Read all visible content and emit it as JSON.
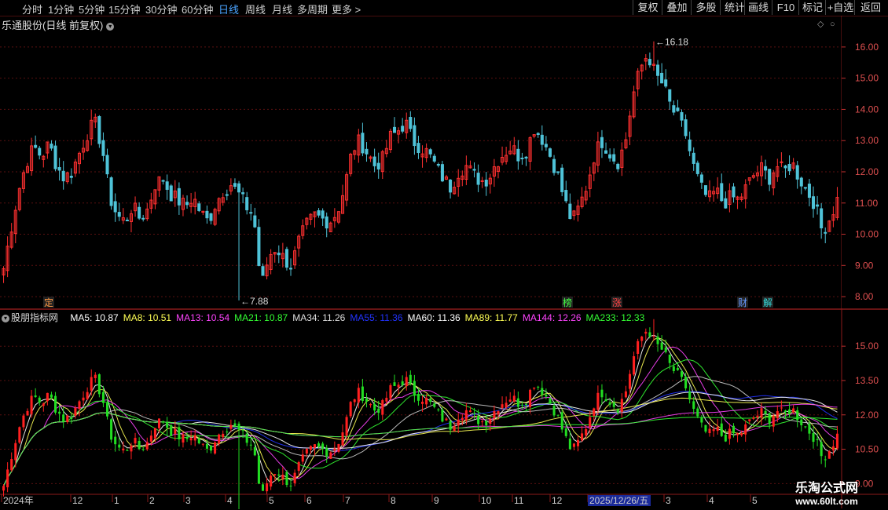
{
  "toolbar": {
    "timeframes": [
      "分时",
      "1分钟",
      "5分钟",
      "15分钟",
      "30分钟",
      "60分钟",
      "日线",
      "周线",
      "月线",
      "多周期",
      "更多 >"
    ],
    "active_timeframe": "日线",
    "right_buttons": [
      "复权",
      "叠加",
      "多股",
      "统计",
      "画线",
      "F10",
      "标记",
      "+自选",
      "返回"
    ]
  },
  "upper": {
    "title": "乐通股份(日线 前复权)",
    "price_axis": [
      "16.00",
      "15.00",
      "14.00",
      "13.00",
      "12.00",
      "11.00",
      "10.00",
      "9.00",
      "8.00"
    ],
    "high_marker": "16.18",
    "low_marker": "7.88",
    "markers": [
      "定",
      "榜",
      "涨",
      "财",
      "解"
    ]
  },
  "lower": {
    "indicator_name": "股朋指标网",
    "ma_legend": [
      {
        "label": "MA5: 10.87",
        "color": "#ffffff"
      },
      {
        "label": "MA8: 10.51",
        "color": "#ffff55"
      },
      {
        "label": "MA13: 10.54",
        "color": "#ff44ff"
      },
      {
        "label": "MA21: 10.87",
        "color": "#33ff33"
      },
      {
        "label": "MA34: 11.26",
        "color": "#dddddd"
      },
      {
        "label": "MA55: 11.36",
        "color": "#2233ff"
      },
      {
        "label": "MA60: 11.36",
        "color": "#ffffff"
      },
      {
        "label": "MA89: 11.77",
        "color": "#ffff55"
      },
      {
        "label": "MA144: 12.26",
        "color": "#ff44ff"
      },
      {
        "label": "MA233: 12.33",
        "color": "#33ff33"
      }
    ],
    "price_axis": [
      "15.00",
      "13.50",
      "12.00",
      "10.50",
      "9.00"
    ]
  },
  "time_axis": [
    "2024年",
    "12",
    "1",
    "2",
    "3",
    "4",
    "5",
    "6",
    "7",
    "8",
    "9",
    "10",
    "11",
    "12",
    "2025/12/26/五",
    "3",
    "4",
    "5"
  ],
  "watermark": {
    "line1": "乐淘公式网",
    "line2": "www.60lt.com"
  },
  "chart_data": {
    "type": "candlestick",
    "series": "乐通股份 daily close (approx.)",
    "closes": [
      8.9,
      10.2,
      11.4,
      12.3,
      12.8,
      12.5,
      12.9,
      12.2,
      11.8,
      12.0,
      12.6,
      13.2,
      13.6,
      12.8,
      11.2,
      10.6,
      10.4,
      10.9,
      10.5,
      10.8,
      11.6,
      11.8,
      11.3,
      11.1,
      10.9,
      11.2,
      10.7,
      10.4,
      11.0,
      11.4,
      11.6,
      11.3,
      10.9,
      10.6,
      8.3,
      9.3,
      9.6,
      9.2,
      9.0,
      9.8,
      10.3,
      10.6,
      10.5,
      10.4,
      10.7,
      11.5,
      12.7,
      13.0,
      12.6,
      12.2,
      12.4,
      13.1,
      13.3,
      13.6,
      13.0,
      12.8,
      12.6,
      12.2,
      11.8,
      11.5,
      12.0,
      12.2,
      11.9,
      11.7,
      11.8,
      12.3,
      12.6,
      12.8,
      12.5,
      12.7,
      13.4,
      13.1,
      12.6,
      12.0,
      11.1,
      10.4,
      10.9,
      11.6,
      12.6,
      13.0,
      12.6,
      12.3,
      12.9,
      14.4,
      15.3,
      15.8,
      15.1,
      14.8,
      14.1,
      13.7,
      13.2,
      12.2,
      11.5,
      11.1,
      11.4,
      11.0,
      11.2,
      11.1,
      11.5,
      11.9,
      12.1,
      11.8,
      12.2,
      12.0,
      12.3,
      11.8,
      11.4,
      11.0,
      10.1,
      10.5,
      11.1
    ],
    "high": 16.18,
    "low": 7.88,
    "upper_ylim": [
      7.7,
      16.5
    ],
    "lower_ylim": [
      8.6,
      16.0
    ],
    "moving_averages": [
      "MA5",
      "MA8",
      "MA13",
      "MA21",
      "MA34",
      "MA55",
      "MA60",
      "MA89",
      "MA144",
      "MA233"
    ]
  }
}
